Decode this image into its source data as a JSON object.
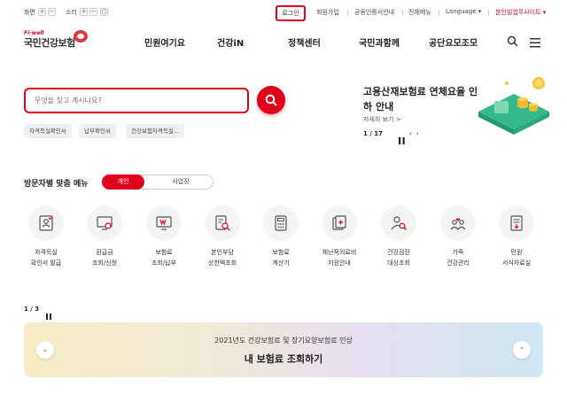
{
  "topbar": {
    "screen_label": "화면",
    "sound_label": "소리",
    "plus": "+",
    "minus": "−",
    "reset": "○",
    "links": [
      "로그인",
      "회원가입",
      "공동인증서안내",
      "전체메뉴",
      "Language ▾",
      "본인빌업무사이트 ▾"
    ]
  },
  "logo": {
    "tagline": "Fi-well",
    "name": "국민건강보험"
  },
  "nav": {
    "items": [
      "민원여기요",
      "건강iN",
      "정책센터",
      "국민과함께",
      "공단요모조모"
    ]
  },
  "search": {
    "placeholder": "무엇을 찾고 계시나요?",
    "chips": [
      "자격득실확인서",
      "납부확인서",
      "건강보험자격득실..."
    ]
  },
  "promo": {
    "title": "고용산재보험료 연체요율 인하 안내",
    "more": "자세히 보기 >",
    "pager": "1 / 17"
  },
  "visitor_menu": {
    "title": "방문자별 맞춤 메뉴",
    "tabs": [
      "개인",
      "사업장"
    ],
    "items": [
      {
        "label": "자격득실\n확인서 발급",
        "icon": "id-card-icon"
      },
      {
        "label": "환급금\n조회/신청",
        "icon": "monitor-coin-icon"
      },
      {
        "label": "보험료\n조회/납부",
        "icon": "monitor-won-icon"
      },
      {
        "label": "본인부담\n상한액조회",
        "icon": "document-search-icon"
      },
      {
        "label": "보험료\n계산기",
        "icon": "calculator-icon"
      },
      {
        "label": "재난적의료비\n지원안내",
        "icon": "support-docs-icon"
      },
      {
        "label": "건강검진\n대상조회",
        "icon": "person-search-icon"
      },
      {
        "label": "가족\n건강관리",
        "icon": "family-heart-icon"
      },
      {
        "label": "민원\n서식자료실",
        "icon": "form-download-icon"
      }
    ],
    "pager": "1 / 3"
  },
  "banner": {
    "subtitle": "2021년도 건강보험료 및 장기요양보험료 인상",
    "title": "내 보험료 조회하기",
    "prev": "⌄",
    "next": "⌃"
  },
  "colors": {
    "accent": "#e0001c",
    "promo_green": "#3cc08f"
  }
}
